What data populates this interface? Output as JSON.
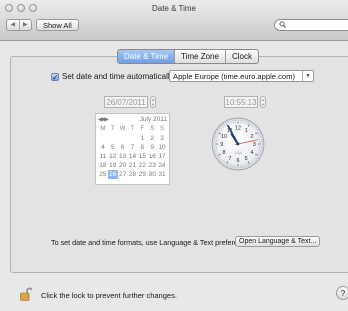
{
  "window": {
    "title": "Date & Time"
  },
  "toolbar": {
    "back_glyph": "◀",
    "forward_glyph": "▶",
    "show_all_label": "Show All",
    "search_placeholder": ""
  },
  "tabs": [
    {
      "label": "Date & Time",
      "active": true
    },
    {
      "label": "Time Zone",
      "active": false
    },
    {
      "label": "Clock",
      "active": false
    }
  ],
  "auto_setting": {
    "checked": true,
    "check_glyph": "✓",
    "label": "Set date and time automatically:",
    "server": "Apple Europe (time.euro.apple.com)"
  },
  "date_field": {
    "value": "26/07/2011"
  },
  "time_field": {
    "value": "10:55:13"
  },
  "calendar": {
    "month_label": "July 2011",
    "weekdays": [
      "M",
      "T",
      "W",
      "T",
      "F",
      "S",
      "S"
    ],
    "weeks": [
      [
        "",
        "",
        "",
        "",
        "1",
        "2",
        "3"
      ],
      [
        "4",
        "5",
        "6",
        "7",
        "8",
        "9",
        "10"
      ],
      [
        "11",
        "12",
        "13",
        "14",
        "15",
        "16",
        "17"
      ],
      [
        "18",
        "19",
        "20",
        "21",
        "22",
        "23",
        "24"
      ],
      [
        "25",
        "26",
        "27",
        "28",
        "29",
        "30",
        "31"
      ]
    ],
    "selected_day": "26"
  },
  "clock": {
    "numerals": [
      "12",
      "1",
      "2",
      "3",
      "4",
      "5",
      "6",
      "7",
      "8",
      "9",
      "10",
      "11"
    ],
    "ampm": "AM",
    "hour": 10,
    "minute": 55,
    "second": 13
  },
  "footer": {
    "formats_text": "To set date and time formats, use Language & Text preferences.",
    "formats_button": "Open Language & Text..."
  },
  "lock": {
    "message": "Click the lock to prevent further changes."
  },
  "help": {
    "label": "?"
  },
  "colors": {
    "accent": "#7aa4e6",
    "selected_day": "#8fb5ea",
    "clock_hand": "#1c3f78",
    "second_hand": "#e03a2a"
  }
}
